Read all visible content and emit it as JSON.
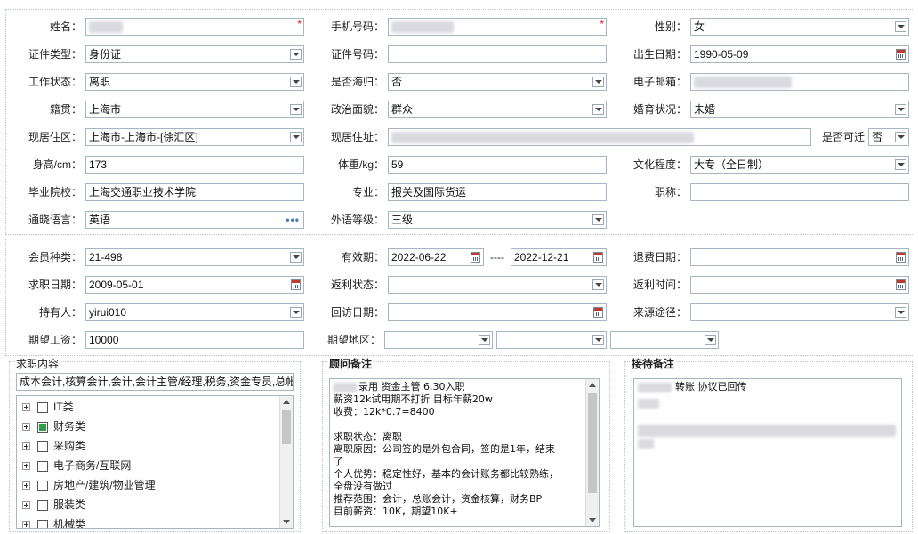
{
  "profile": {
    "name": {
      "label": "姓名：",
      "value": ""
    },
    "mobile": {
      "label": "手机号码：",
      "value": ""
    },
    "gender": {
      "label": "性别：",
      "value": "女"
    },
    "id_type": {
      "label": "证件类型：",
      "value": "身份证"
    },
    "id_number": {
      "label": "证件号码：",
      "value": ""
    },
    "birth_date": {
      "label": "出生日期：",
      "value": "1990-05-09"
    },
    "work_status": {
      "label": "工作状态：",
      "value": "离职"
    },
    "returnee": {
      "label": "是否海归：",
      "value": "否"
    },
    "email": {
      "label": "电子邮箱：",
      "value": ""
    },
    "native_place": {
      "label": "籍贯：",
      "value": "上海市"
    },
    "political": {
      "label": "政治面貌：",
      "value": "群众"
    },
    "marital": {
      "label": "婚育状况：",
      "value": "未婚"
    },
    "residence_area": {
      "label": "现居住区：",
      "value": "上海市-上海市-[徐汇区]"
    },
    "residence_address": {
      "label": "现居住址：",
      "value": ""
    },
    "relocate": {
      "label": "是否可迁",
      "value": "否"
    },
    "height": {
      "label": "身高/cm：",
      "value": "173"
    },
    "weight": {
      "label": "体重/kg：",
      "value": "59"
    },
    "education": {
      "label": "文化程度：",
      "value": "大专（全日制）"
    },
    "school": {
      "label": "毕业院校：",
      "value": "上海交通职业技术学院"
    },
    "major": {
      "label": "专业：",
      "value": "报关及国际货运"
    },
    "title": {
      "label": "职称：",
      "value": ""
    },
    "language": {
      "label": "通晓语言：",
      "value": "英语"
    },
    "language_level": {
      "label": "外语等级：",
      "value": "三级"
    }
  },
  "membership": {
    "member_type": {
      "label": "会员种类：",
      "value": "21-498"
    },
    "valid_period": {
      "label": "有效期：",
      "start": "2022-06-22",
      "sep": "----",
      "end": "2022-12-21"
    },
    "refund_date": {
      "label": "退费日期：",
      "value": ""
    },
    "job_search_date": {
      "label": "求职日期：",
      "value": "2009-05-01"
    },
    "rebate_status": {
      "label": "返利状态：",
      "value": ""
    },
    "rebate_time": {
      "label": "返利时间：",
      "value": ""
    },
    "holder": {
      "label": "持有人：",
      "value": "yirui010"
    },
    "visit_date": {
      "label": "回访日期：",
      "value": ""
    },
    "source": {
      "label": "来源途径：",
      "value": ""
    },
    "expected_salary": {
      "label": "期望工资：",
      "value": "10000"
    },
    "expected_area": {
      "label": "期望地区：",
      "values": [
        "",
        "",
        ""
      ]
    }
  },
  "job_content": {
    "title": "求职内容",
    "summary": "成本会计,核算会计,会计,会计主管/经理,税务,资金专员,总帐",
    "categories": [
      {
        "label": "IT类",
        "checked": false
      },
      {
        "label": "财务类",
        "checked": true
      },
      {
        "label": "采购类",
        "checked": false
      },
      {
        "label": "电子商务/互联网",
        "checked": false
      },
      {
        "label": "房地产/建筑/物业管理",
        "checked": false
      },
      {
        "label": "服装类",
        "checked": false
      },
      {
        "label": "机械类",
        "checked": false
      }
    ]
  },
  "advisor_notes": {
    "title": "顾问备注",
    "lines": [
      "录用 资金主管  6.30入职",
      "薪资12k试用期不打折  目标年薪20w",
      "收费：12k*0.7=8400",
      "",
      "求职状态：离职",
      "离职原因：公司签的是外包合同，签的是1年，结束",
      "了",
      "个人优势：稳定性好，基本的会计账务都比较熟练，",
      "全盘没有做过",
      "推荐范围：会计，总账会计，资金核算，财务BP",
      "目前薪资：10K，期望10K+"
    ]
  },
  "reception_notes": {
    "title": "接待备注",
    "lines": [
      "转账 协议已回传"
    ]
  },
  "colors": {
    "required": "#dd2222",
    "border": "#a7b6c5",
    "check_on": "#2e9e45"
  }
}
